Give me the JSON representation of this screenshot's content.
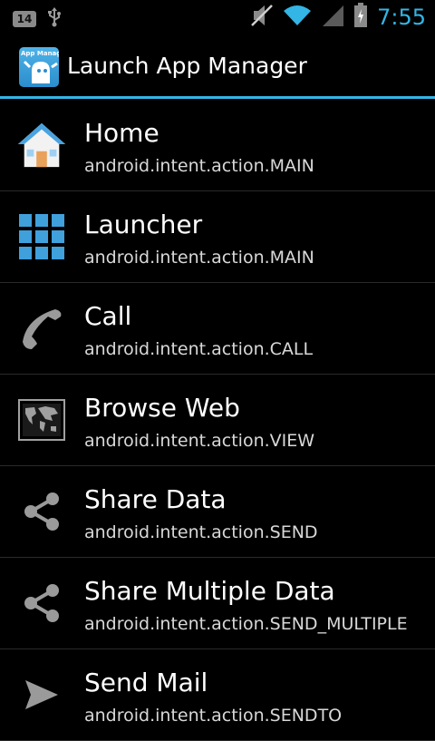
{
  "status_bar": {
    "notification_count": "14",
    "time": "7:55",
    "icons": [
      "usb-icon",
      "mute-icon",
      "wifi-icon",
      "signal-icon",
      "battery-icon"
    ]
  },
  "action_bar": {
    "app_icon_label": "App Manager",
    "title": "Launch App Manager"
  },
  "intents": [
    {
      "title": "Home",
      "action": "android.intent.action.MAIN",
      "icon": "home-icon"
    },
    {
      "title": "Launcher",
      "action": "android.intent.action.MAIN",
      "icon": "launcher-grid-icon"
    },
    {
      "title": "Call",
      "action": "android.intent.action.CALL",
      "icon": "phone-icon"
    },
    {
      "title": "Browse Web",
      "action": "android.intent.action.VIEW",
      "icon": "world-map-icon"
    },
    {
      "title": "Share Data",
      "action": "android.intent.action.SEND",
      "icon": "share-icon"
    },
    {
      "title": "Share Multiple Data",
      "action": "android.intent.action.SEND_MULTIPLE",
      "icon": "share-icon"
    },
    {
      "title": "Send Mail",
      "action": "android.intent.action.SENDTO",
      "icon": "send-icon"
    }
  ],
  "colors": {
    "accent": "#33b5e5",
    "background": "#000000",
    "divider": "#2a2a2a"
  }
}
